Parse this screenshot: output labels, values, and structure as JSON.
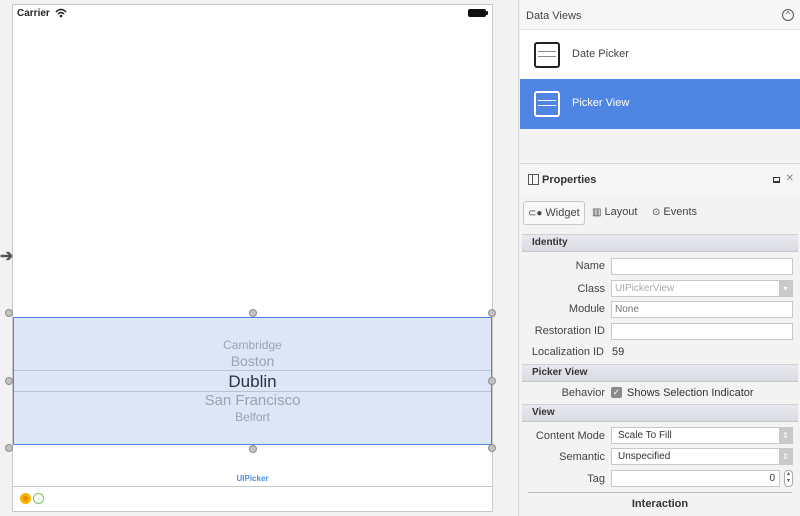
{
  "canvas": {
    "status_bar": {
      "carrier": "Carrier"
    },
    "picker": {
      "items": [
        {
          "label": "Cambridge",
          "selected": false
        },
        {
          "label": "Boston",
          "selected": false
        },
        {
          "label": "Dublin",
          "selected": true
        },
        {
          "label": "San Francisco",
          "selected": false
        },
        {
          "label": "Belfort",
          "selected": false
        }
      ],
      "selection_color": "#4a86e8"
    },
    "scene_label": "UIPicker"
  },
  "data_views": {
    "title": "Data Views",
    "items": [
      {
        "label": "Date Picker",
        "icon": "date-picker-icon",
        "selected": false
      },
      {
        "label": "Picker View",
        "icon": "picker-view-icon",
        "selected": true
      }
    ],
    "selected_color": "#4f86e4"
  },
  "properties": {
    "title": "Properties",
    "tabs": [
      {
        "label": "Widget",
        "icon": "widget-icon",
        "active": true
      },
      {
        "label": "Layout",
        "icon": "layout-icon",
        "active": false
      },
      {
        "label": "Events",
        "icon": "events-icon",
        "active": false
      }
    ],
    "identity": {
      "section": "Identity",
      "name_label": "Name",
      "name_value": "",
      "class_label": "Class",
      "class_placeholder": "UIPickerView",
      "module_label": "Module",
      "module_placeholder": "None",
      "restoration_label": "Restoration ID",
      "restoration_value": "",
      "localization_label": "Localization ID",
      "localization_value": "59"
    },
    "picker_view": {
      "section": "Picker View",
      "behavior_label": "Behavior",
      "shows_selection_indicator": true,
      "shows_selection_label": "Shows Selection Indicator"
    },
    "view": {
      "section": "View",
      "content_mode_label": "Content Mode",
      "content_mode_value": "Scale To Fill",
      "semantic_label": "Semantic",
      "semantic_value": "Unspecified",
      "tag_label": "Tag",
      "tag_value": "0",
      "interaction_label": "Interaction"
    }
  }
}
